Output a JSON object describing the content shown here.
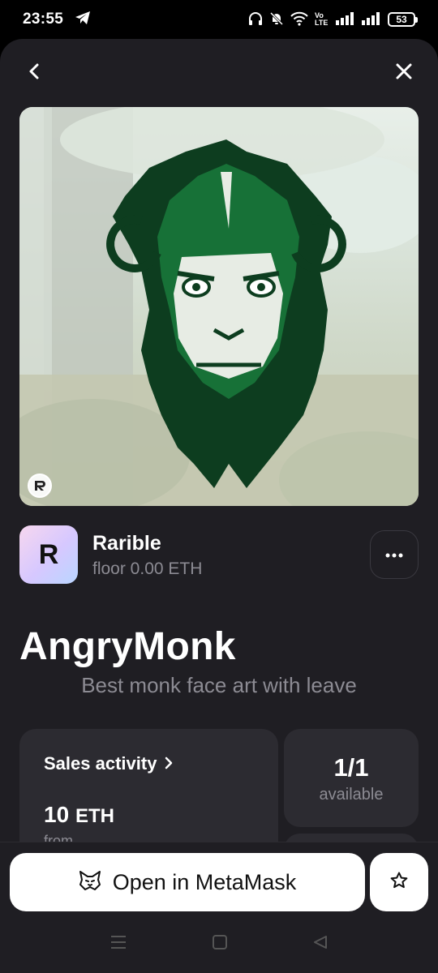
{
  "status_bar": {
    "time": "23:55",
    "battery": "53",
    "network_label": "Vo LTE"
  },
  "nft": {
    "image_icon": "rarible-mark-icon",
    "title": "AngryMonk",
    "description": "Best monk face art with leave"
  },
  "collection": {
    "logo_letter": "R",
    "name": "Rarible",
    "floor": "floor 0.00 ETH"
  },
  "stats": {
    "sales_label": "Sales activity",
    "sales_value": "10",
    "sales_unit": "ETH",
    "sales_from": "from",
    "available_value": "1/1",
    "available_label": "available"
  },
  "actions": {
    "open_label": "Open in MetaMask",
    "open_icon": "metamask-fox-icon",
    "favorite_icon": "star-icon"
  },
  "colors": {
    "background": "#1f1e23",
    "card": "#2c2b31",
    "muted_text": "#8c8b93",
    "accent_green": "#1a7a3c"
  }
}
